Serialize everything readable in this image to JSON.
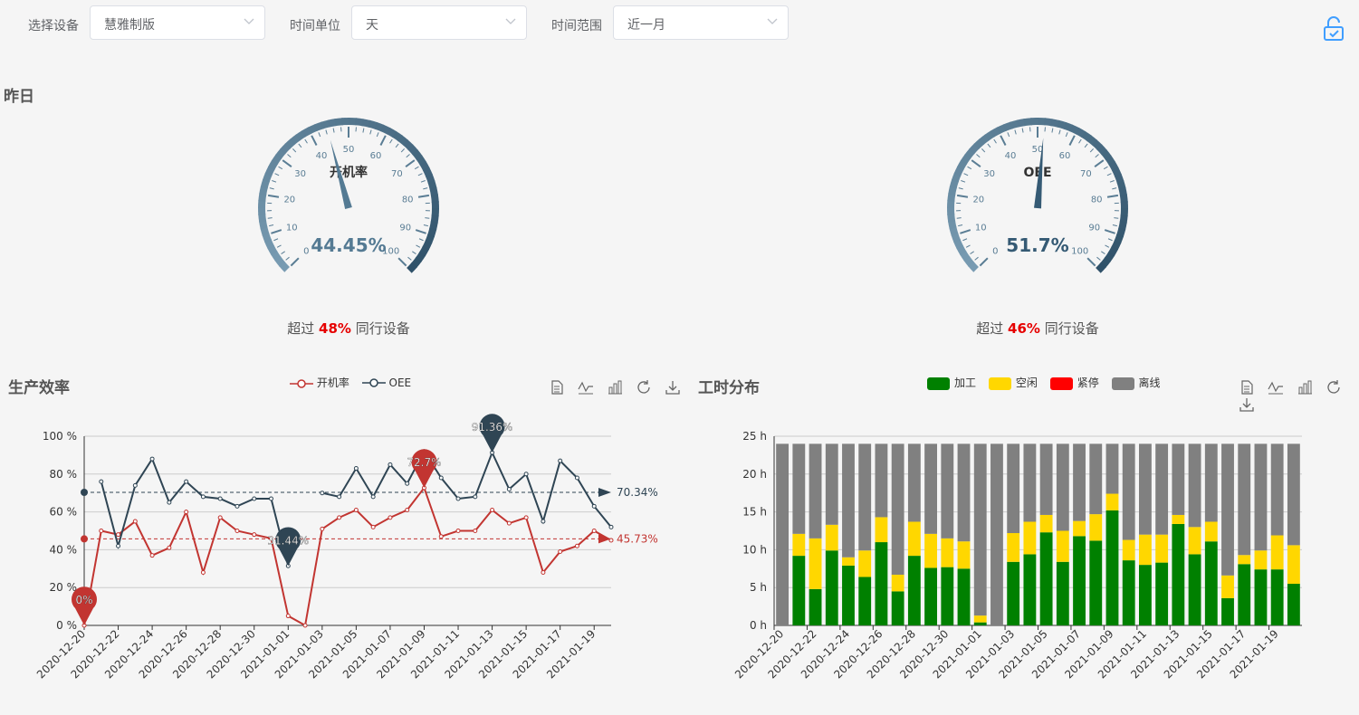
{
  "filters": {
    "device_label": "选择设备",
    "device_value": "慧雅制版",
    "unit_label": "时间单位",
    "unit_value": "天",
    "range_label": "时间范围",
    "range_value": "近一月"
  },
  "icons": {
    "lock": "lock-open-icon",
    "chevron": "chevron-down-icon"
  },
  "yesterday": {
    "title": "昨日",
    "gauges": [
      {
        "name": "开机率",
        "value": 44.45,
        "display": "44.45%",
        "exceed_prefix": "超过 ",
        "exceed_pct": "48%",
        "exceed_suffix": " 同行设备",
        "color": "#547a93"
      },
      {
        "name": "OEE",
        "value": 51.7,
        "display": "51.7%",
        "exceed_prefix": "超过 ",
        "exceed_pct": "46%",
        "exceed_suffix": " 同行设备",
        "color": "#355a74"
      }
    ],
    "gauge_ticks": [
      "0",
      "10",
      "20",
      "30",
      "40",
      "50",
      "60",
      "70",
      "80",
      "90",
      "100"
    ]
  },
  "efficiency": {
    "title": "生产效率",
    "legend": [
      "开机率",
      "OEE"
    ],
    "colors": {
      "rate": "#c23531",
      "oee": "#2f4554"
    }
  },
  "worktime": {
    "title": "工时分布",
    "legend": [
      "加工",
      "空闲",
      "紧停",
      "离线"
    ],
    "colors": [
      "#008000",
      "#ffd700",
      "#ff0000",
      "#808080"
    ]
  },
  "chart_data": [
    {
      "type": "line",
      "title": "生产效率",
      "x": [
        "2020-12-20",
        "2020-12-21",
        "2020-12-22",
        "2020-12-23",
        "2020-12-24",
        "2020-12-25",
        "2020-12-26",
        "2020-12-27",
        "2020-12-28",
        "2020-12-29",
        "2020-12-30",
        "2020-12-31",
        "2021-01-01",
        "2021-01-02",
        "2021-01-03",
        "2021-01-04",
        "2021-01-05",
        "2021-01-06",
        "2021-01-07",
        "2021-01-08",
        "2021-01-09",
        "2021-01-10",
        "2021-01-11",
        "2021-01-12",
        "2021-01-13",
        "2021-01-14",
        "2021-01-15",
        "2021-01-16",
        "2021-01-17",
        "2021-01-18",
        "2021-01-19",
        "2021-01-20"
      ],
      "xticks": [
        "2020-12-20",
        "2020-12-22",
        "2020-12-24",
        "2020-12-26",
        "2020-12-28",
        "2020-12-30",
        "2021-01-01",
        "2021-01-03",
        "2021-01-05",
        "2021-01-07",
        "2021-01-09",
        "2021-01-11",
        "2021-01-13",
        "2021-01-15",
        "2021-01-17",
        "2021-01-19"
      ],
      "yticks": [
        "0 %",
        "20 %",
        "40 %",
        "60 %",
        "80 %",
        "100 %"
      ],
      "ylim": [
        0,
        100
      ],
      "series": [
        {
          "name": "开机率",
          "values": [
            0,
            50,
            48,
            55,
            37,
            41,
            60,
            28,
            57,
            50,
            48,
            46,
            5,
            0,
            51,
            57,
            61,
            52,
            57,
            61,
            72.7,
            47,
            50,
            50,
            61,
            54,
            57,
            28,
            39,
            42,
            50,
            45
          ]
        },
        {
          "name": "OEE",
          "values": [
            null,
            76,
            42,
            74,
            88,
            65,
            76,
            68,
            67,
            63,
            67,
            67,
            31.44,
            null,
            70,
            68,
            83,
            68,
            85,
            75,
            92,
            78,
            67,
            68,
            91.36,
            72,
            80,
            55,
            87,
            78,
            63,
            52
          ]
        }
      ],
      "mark_points": [
        {
          "series": "开机率",
          "label": "0%",
          "x": "2020-12-20",
          "y": 0
        },
        {
          "series": "开机率",
          "label": "72.7%",
          "x": "2021-01-09",
          "y": 72.7
        },
        {
          "series": "OEE",
          "label": "31.44%",
          "x": "2021-01-01",
          "y": 31.44
        },
        {
          "series": "OEE",
          "label": "91.36%",
          "x": "2021-01-13",
          "y": 91.36
        }
      ],
      "mark_lines": [
        {
          "series": "开机率",
          "label": "45.73%",
          "y": 45.73
        },
        {
          "series": "OEE",
          "label": "70.34%",
          "y": 70.34
        }
      ]
    },
    {
      "type": "bar",
      "title": "工时分布",
      "categories": [
        "2020-12-20",
        "2020-12-21",
        "2020-12-22",
        "2020-12-23",
        "2020-12-24",
        "2020-12-25",
        "2020-12-26",
        "2020-12-27",
        "2020-12-28",
        "2020-12-29",
        "2020-12-30",
        "2020-12-31",
        "2021-01-01",
        "2021-01-02",
        "2021-01-03",
        "2021-01-04",
        "2021-01-05",
        "2021-01-06",
        "2021-01-07",
        "2021-01-08",
        "2021-01-09",
        "2021-01-10",
        "2021-01-11",
        "2021-01-12",
        "2021-01-13",
        "2021-01-14",
        "2021-01-15",
        "2021-01-16",
        "2021-01-17",
        "2021-01-18",
        "2021-01-19",
        "2021-01-20"
      ],
      "xticks": [
        "2020-12-20",
        "2020-12-22",
        "2020-12-24",
        "2020-12-26",
        "2020-12-28",
        "2020-12-30",
        "2021-01-01",
        "2021-01-03",
        "2021-01-05",
        "2021-01-07",
        "2021-01-09",
        "2021-01-11",
        "2021-01-13",
        "2021-01-15",
        "2021-01-17",
        "2021-01-19"
      ],
      "yticks": [
        "0 h",
        "5 h",
        "10 h",
        "15 h",
        "20 h",
        "25 h"
      ],
      "ylim": [
        0,
        25
      ],
      "stacked": true,
      "series": [
        {
          "name": "加工",
          "values": [
            0,
            9.2,
            4.8,
            9.9,
            7.9,
            6.4,
            11,
            4.5,
            9.2,
            7.6,
            7.7,
            7.5,
            0.4,
            0,
            8.4,
            9.4,
            12.3,
            8.4,
            11.8,
            11.2,
            15.2,
            8.6,
            8,
            8.3,
            13.4,
            9.4,
            11.1,
            3.6,
            8.1,
            7.4,
            7.4,
            5.5
          ]
        },
        {
          "name": "空闲",
          "values": [
            0,
            2.9,
            6.7,
            3.4,
            1.1,
            3.5,
            3.3,
            2.2,
            4.5,
            4.5,
            3.8,
            3.6,
            0.9,
            0,
            3.8,
            4.3,
            2.3,
            4.1,
            2,
            3.5,
            2.2,
            2.7,
            4,
            3.7,
            1.2,
            3.6,
            2.6,
            3,
            1.2,
            2.5,
            4.5,
            5.1
          ]
        },
        {
          "name": "紧停",
          "values": [
            0,
            0,
            0,
            0,
            0,
            0,
            0,
            0,
            0,
            0,
            0,
            0,
            0,
            0,
            0,
            0,
            0,
            0,
            0,
            0,
            0,
            0,
            0,
            0,
            0,
            0,
            0,
            0,
            0,
            0,
            0,
            0
          ]
        },
        {
          "name": "离线",
          "values": [
            24,
            11.9,
            12.5,
            10.7,
            15,
            14.1,
            9.7,
            17.3,
            10.3,
            11.9,
            12.5,
            12.9,
            22.7,
            24,
            11.8,
            10.3,
            9.4,
            11.5,
            10.2,
            9.3,
            6.6,
            12.7,
            12,
            12,
            9.4,
            11,
            10.3,
            17.4,
            14.7,
            14.1,
            12.1,
            13.4
          ]
        }
      ]
    }
  ]
}
